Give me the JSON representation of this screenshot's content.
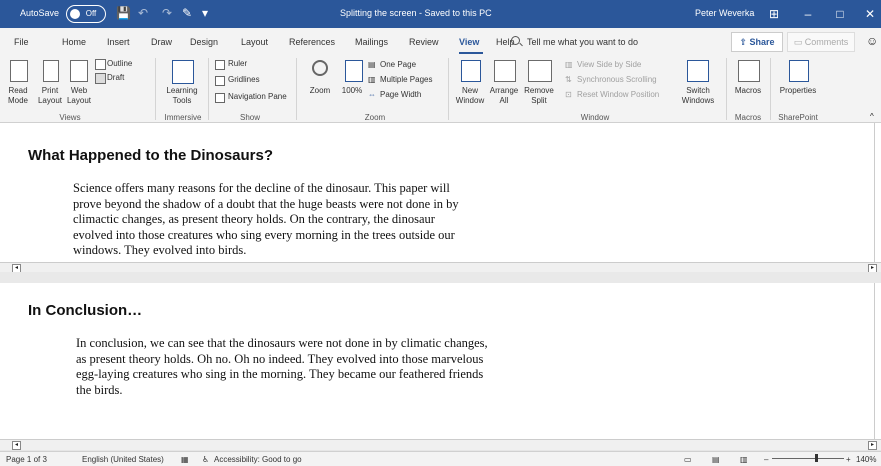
{
  "titlebar": {
    "autosave_label": "AutoSave",
    "autosave_state": "Off",
    "doc_title": "Splitting the screen - Saved to this PC",
    "user": "Peter Weverka"
  },
  "menubar": {
    "tabs": [
      "File",
      "Home",
      "Insert",
      "Draw",
      "Design",
      "Layout",
      "References",
      "Mailings",
      "Review",
      "View",
      "Help"
    ],
    "active_tab": "View",
    "search_placeholder": "Tell me what you want to do",
    "share_label": "Share",
    "comments_label": "Comments"
  },
  "ribbon": {
    "views": {
      "read_mode": "Read Mode",
      "print_layout": "Print Layout",
      "web_layout": "Web Layout",
      "outline": "Outline",
      "draft": "Draft",
      "group": "Views"
    },
    "immersive": {
      "learning_tools": "Learning Tools",
      "group": "Immersive"
    },
    "show": {
      "ruler": "Ruler",
      "gridlines": "Gridlines",
      "navigation_pane": "Navigation Pane",
      "group": "Show"
    },
    "zoom": {
      "zoom": "Zoom",
      "percent": "100%",
      "one_page": "One Page",
      "multiple_pages": "Multiple Pages",
      "page_width": "Page Width",
      "group": "Zoom"
    },
    "window": {
      "new_window": "New Window",
      "arrange_all": "Arrange All",
      "remove_split": "Remove Split",
      "view_side": "View Side by Side",
      "sync_scroll": "Synchronous Scrolling",
      "reset_position": "Reset Window Position",
      "switch_windows": "Switch Windows",
      "group": "Window"
    },
    "macros": {
      "macros": "Macros",
      "group": "Macros"
    },
    "sharepoint": {
      "properties": "Properties",
      "group": "SharePoint"
    }
  },
  "pane1": {
    "heading": "What Happened to the Dinosaurs?",
    "lines": [
      "Science offers many reasons for the decline of the dinosaur. This paper will",
      "prove beyond the shadow of a doubt that the huge beasts were not done in by",
      "climactic changes, as present theory holds. On the contrary, the dinosaur",
      "evolved into those creatures who sing every morning in the trees outside our",
      "windows. They evolved into birds."
    ]
  },
  "pane2": {
    "heading": "In Conclusion…",
    "lines": [
      "In conclusion, we can see that the dinosaurs were not done in by climatic changes,",
      "as present theory holds. Oh no. Oh no indeed. They evolved into those marvelous",
      "egg-laying creatures who sing in the morning. They became our feathered friends",
      "the birds."
    ]
  },
  "statusbar": {
    "page": "Page 1 of 3",
    "language": "English (United States)",
    "accessibility": "Accessibility: Good to go",
    "zoom": "140%"
  },
  "colors": {
    "accent": "#2b579a",
    "ribbon_bg": "#f3f3f3"
  }
}
